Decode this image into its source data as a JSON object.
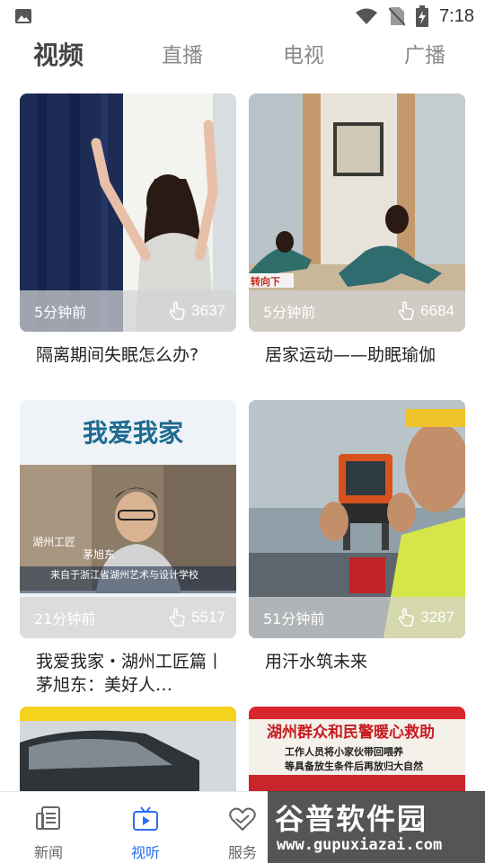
{
  "status_bar": {
    "time": "7:18"
  },
  "top_tabs": [
    {
      "label": "视频",
      "active": true
    },
    {
      "label": "直播",
      "active": false
    },
    {
      "label": "电视",
      "active": false
    },
    {
      "label": "广播",
      "active": false
    }
  ],
  "videos": [
    {
      "title": "隔离期间失眠怎么办?",
      "time_ago": "5分钟前",
      "views": "3637"
    },
    {
      "title": "居家运动——助眠瑜伽",
      "time_ago": "5分钟前",
      "views": "6684"
    },
    {
      "title": "我爱我家・湖州工匠篇丨茅旭东：美好人…",
      "time_ago": "21分钟前",
      "views": "5517",
      "thumb_text": [
        "我爱我家",
        "湖州工匠",
        "茅旭东",
        "来自于浙江省湖州艺术与设计学校"
      ]
    },
    {
      "title": "用汗水筑未来",
      "time_ago": "51分钟前",
      "views": "3287"
    },
    {
      "title": "",
      "time_ago": "",
      "views": ""
    },
    {
      "title": "",
      "time_ago": "",
      "views": "",
      "thumb_text": [
        "湖州群众和民警暖心救助",
        "工作人员将小家伙带回喂养",
        "等具备放生条件后再放归大自然"
      ]
    }
  ],
  "thumb_caption_yoga": "转向下",
  "bottom_nav": [
    {
      "label": "新闻",
      "icon": "news-icon",
      "active": false
    },
    {
      "label": "视听",
      "icon": "tv-icon",
      "active": true
    },
    {
      "label": "服务",
      "icon": "heart-icon",
      "active": false
    }
  ],
  "watermark": {
    "title": "谷普软件园",
    "url": "www.gupuxiazai.com"
  },
  "colors": {
    "accent": "#2a6df5",
    "text": "#222222",
    "muted": "#8a8a8a"
  }
}
